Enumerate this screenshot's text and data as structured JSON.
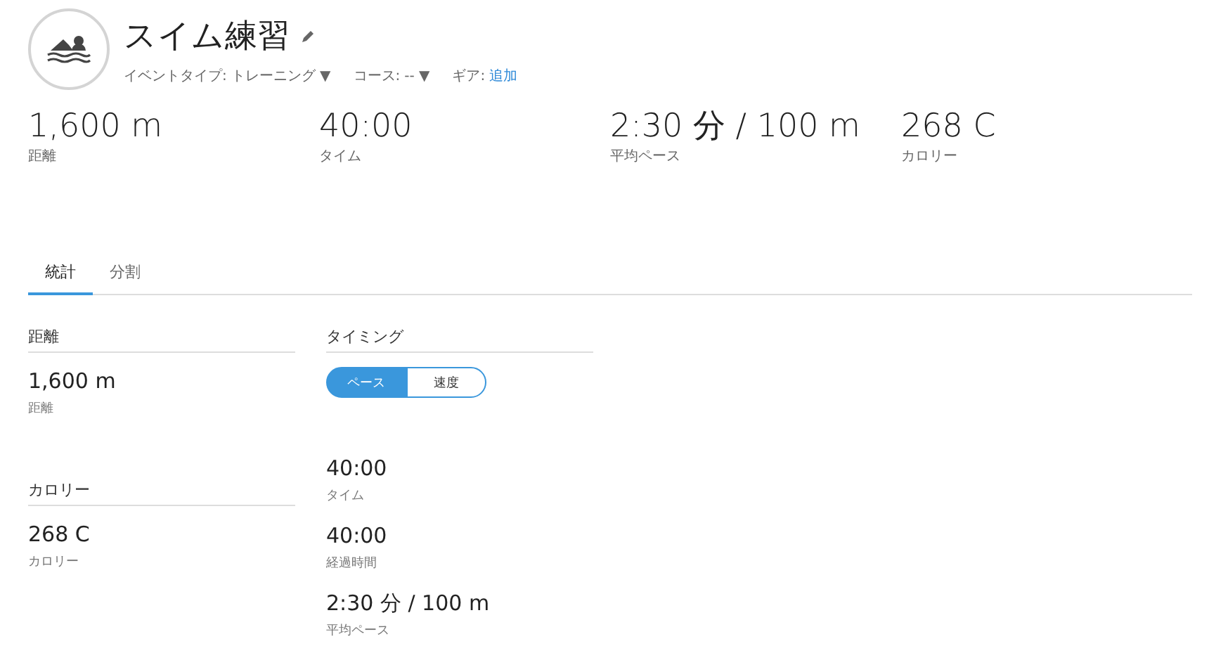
{
  "header": {
    "title": "スイム練習",
    "meta": [
      {
        "kind": "dropdown",
        "label": "イベントタイプ:",
        "value": "トレーニング",
        "caret": "▼"
      },
      {
        "kind": "dropdown",
        "label": "コース:",
        "value": "--",
        "caret": "▼"
      },
      {
        "kind": "link",
        "label": "ギア:",
        "value": "追加"
      }
    ]
  },
  "summary": [
    {
      "value": "1,600 m",
      "label": "距離"
    },
    {
      "value": "40:00",
      "label": "タイム"
    },
    {
      "value": "2:30 分 / 100 m",
      "label": "平均ペース"
    },
    {
      "value": "268 C",
      "label": "カロリー"
    }
  ],
  "tabs": [
    {
      "label": "統計",
      "selected": true
    },
    {
      "label": "分割",
      "selected": false
    }
  ],
  "sections": [
    {
      "title": "距離",
      "stats": [
        {
          "value": "1,600 m",
          "label": "距離"
        }
      ]
    },
    {
      "title": "カロリー",
      "stats": [
        {
          "value": "268 C",
          "label": "カロリー"
        }
      ]
    },
    {
      "title": "タイミング",
      "toggle": [
        {
          "label": "ペース",
          "selected": true
        },
        {
          "label": "速度",
          "selected": false
        }
      ],
      "stats": [
        {
          "value": "40:00",
          "label": "タイム"
        },
        {
          "value": "40:00",
          "label": "経過時間"
        },
        {
          "value": "2:30 分 / 100 m",
          "label": "平均ペース"
        }
      ]
    }
  ]
}
